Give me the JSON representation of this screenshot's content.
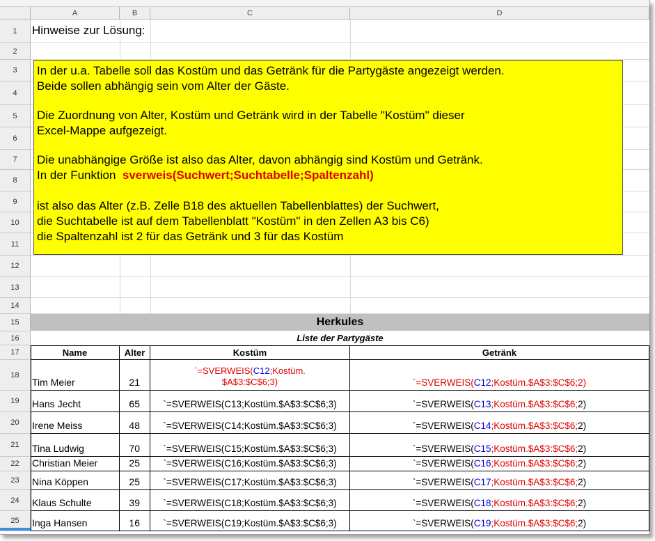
{
  "columns": [
    "A",
    "B",
    "C",
    "D"
  ],
  "rows": [
    "1",
    "2",
    "3",
    "4",
    "5",
    "6",
    "7",
    "8",
    "9",
    "10",
    "11",
    "12",
    "13",
    "14",
    "15",
    "16",
    "17",
    "18",
    "19",
    "20",
    "21",
    "22",
    "23",
    "24",
    "25"
  ],
  "heading": "Hinweise zur Lösung:",
  "note": {
    "line1": "In der u.a. Tabelle soll das Kostüm und das Getränk für die Partygäste angezeigt werden.",
    "line2": "Beide sollen abhängig sein vom Alter der Gäste.",
    "line3": "Die Zuordnung von Alter, Kostüm und Getränk wird in der Tabelle \"Kostüm\" dieser",
    "line4": "Excel-Mappe aufgezeigt.",
    "line5": "Die unabhängige Größe ist also das Alter, davon abhängig sind Kostüm und Getränk.",
    "line6_prefix": "In der Funktion",
    "line6_func": "sverweis(Suchwert;Suchtabelle;Spaltenzahl)",
    "line7": "ist also das Alter (z.B. Zelle B18 des aktuellen Tabellenblattes) der Suchwert,",
    "line8": "die Suchtabelle ist auf dem Tabellenblatt \"Kostüm\" in den Zellen A3 bis C6)",
    "line9": "die Spaltenzahl ist 2 für das Getränk und 3 für das Kostüm"
  },
  "band_title": "Herkules",
  "subtitle": "Liste der Partygäste",
  "table": {
    "headers": [
      "Name",
      "Alter",
      "Kostüm",
      "Getränk"
    ],
    "rows": [
      {
        "name": "Tim Meier",
        "age": "21",
        "k_pre": "`=SVERWEIS(",
        "k_ref": "C12",
        "k_post": ";Kostüm.",
        "k_line2": "$A$3:$C$6;3)",
        "g_pre": "`=SVERWEIS(",
        "g_ref": "C12",
        "g_post": ";Kostüm.$A$3:$C$6;2)"
      },
      {
        "name": "Hans Jecht",
        "age": "65",
        "k": "`=SVERWEIS(C13;Kostüm.$A$3:$C$6;3)",
        "g_pre": "`=SVERWEIS(",
        "g_ref": "C13",
        "g_mid": ";Kostüm.$A$3:$C$6;",
        "g_end": "2)"
      },
      {
        "name": "Irene Meiss",
        "age": "48",
        "k": "`=SVERWEIS(C14;Kostüm.$A$3:$C$6;3)",
        "g_pre": "`=SVERWEIS(",
        "g_ref": "C14",
        "g_mid": ";Kostüm.$A$3:$C$6;",
        "g_end": "2)"
      },
      {
        "name": "Tina Ludwig",
        "age": "70",
        "k": "`=SVERWEIS(C15;Kostüm.$A$3:$C$6;3)",
        "g_pre": "`=SVERWEIS(",
        "g_ref": "C15",
        "g_mid": ";Kostüm.$A$3:$C$6;",
        "g_end": "2)"
      },
      {
        "name": "Christian Meier",
        "age": "25",
        "k": "`=SVERWEIS(C16;Kostüm.$A$3:$C$6;3)",
        "g_pre": "`=SVERWEIS(",
        "g_ref": "C16",
        "g_mid": ";Kostüm.$A$3:$C$6;",
        "g_end": "2)"
      },
      {
        "name": "Nina Köppen",
        "age": "25",
        "k": "`=SVERWEIS(C17;Kostüm.$A$3:$C$6;3)",
        "g_pre": "`=SVERWEIS(",
        "g_ref": "C17",
        "g_mid": ";Kostüm.$A$3:$C$6;",
        "g_end": "2)"
      },
      {
        "name": "Klaus Schulte",
        "age": "39",
        "k": "`=SVERWEIS(C18;Kostüm.$A$3:$C$6;3)",
        "g_pre": "`=SVERWEIS(",
        "g_ref": "C18",
        "g_mid": ";Kostüm.$A$3:$C$6;",
        "g_end": "2)"
      },
      {
        "name": "Inga Hansen",
        "age": "16",
        "k": "`=SVERWEIS(C19;Kostüm.$A$3:$C$6;3)",
        "g_pre": "`=SVERWEIS(",
        "g_ref": "C19",
        "g_mid": ";Kostüm.$A$3:$C$6;",
        "g_end": "2)"
      }
    ]
  },
  "colors": {
    "highlight": "#ffff00",
    "formula_red": "#e00000",
    "ref_blue": "#0000dd",
    "band": "#c0c0c0"
  }
}
